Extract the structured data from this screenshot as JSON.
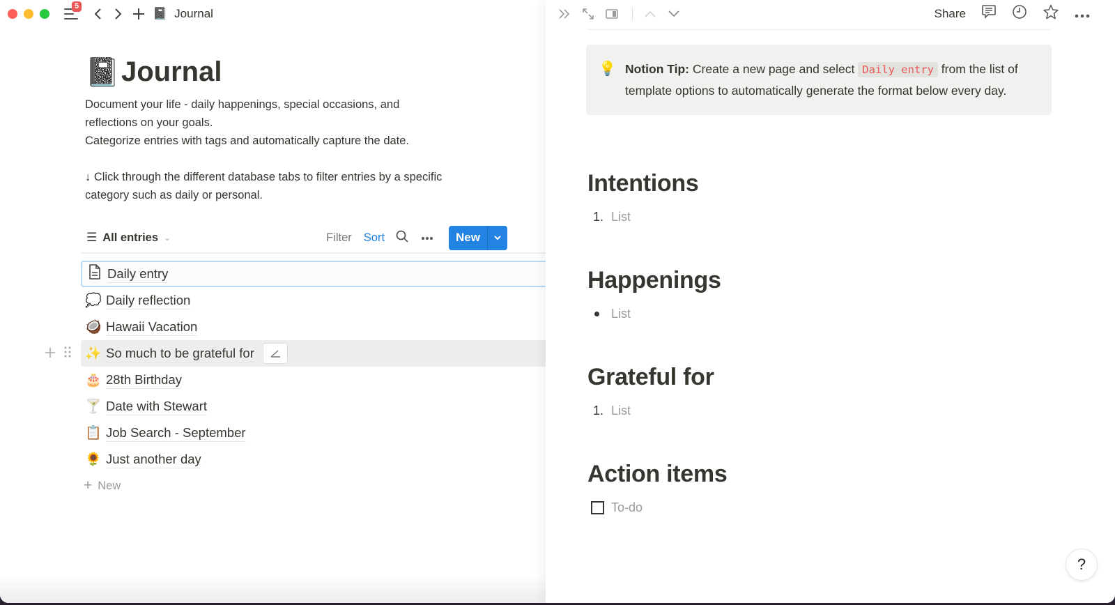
{
  "app": {
    "notification_count": "5",
    "breadcrumb": {
      "emoji": "📓",
      "label": "Journal"
    }
  },
  "page": {
    "emoji": "📓",
    "title": "Journal",
    "description_lines": [
      "Document your life - daily happenings, special occasions, and reflections on your goals.",
      "Categorize entries with tags and automatically capture the date.",
      "↓ Click through the different database tabs to filter entries by a specific category such as daily or personal."
    ]
  },
  "database": {
    "view_label": "All entries",
    "toolbar": {
      "filter": "Filter",
      "sort": "Sort",
      "new": "New"
    },
    "colors": {
      "accent": "#2383e2",
      "sort_active": "#2383e2"
    },
    "entries": [
      {
        "emoji": "📄",
        "title": "Daily entry",
        "state": "selected"
      },
      {
        "emoji": "💭",
        "title": "Daily reflection"
      },
      {
        "emoji": "🥥",
        "title": "Hawaii Vacation"
      },
      {
        "emoji": "✨",
        "title": "So much to be grateful for",
        "state": "hovered"
      },
      {
        "emoji": "🎂",
        "title": "28th Birthday"
      },
      {
        "emoji": "🍸",
        "title": "Date with Stewart"
      },
      {
        "emoji": "📋",
        "title": "Job Search - September"
      },
      {
        "emoji": "🌻",
        "title": "Just another day"
      }
    ],
    "add_label": "New"
  },
  "peek": {
    "share_label": "Share",
    "callout": {
      "emoji": "💡",
      "bold": "Notion Tip:",
      "text_before": " Create a new page and select ",
      "code": "Daily entry",
      "text_after": " from the list of template options to automatically generate the format below every day."
    },
    "sections": [
      {
        "heading": "Intentions",
        "type": "numbered",
        "marker": "1.",
        "placeholder": "List"
      },
      {
        "heading": "Happenings",
        "type": "bulleted",
        "marker": "",
        "placeholder": "List"
      },
      {
        "heading": "Grateful for",
        "type": "numbered",
        "marker": "1.",
        "placeholder": "List"
      },
      {
        "heading": "Action items",
        "type": "todo",
        "marker": "",
        "placeholder": "To-do"
      }
    ],
    "help_label": "?"
  }
}
